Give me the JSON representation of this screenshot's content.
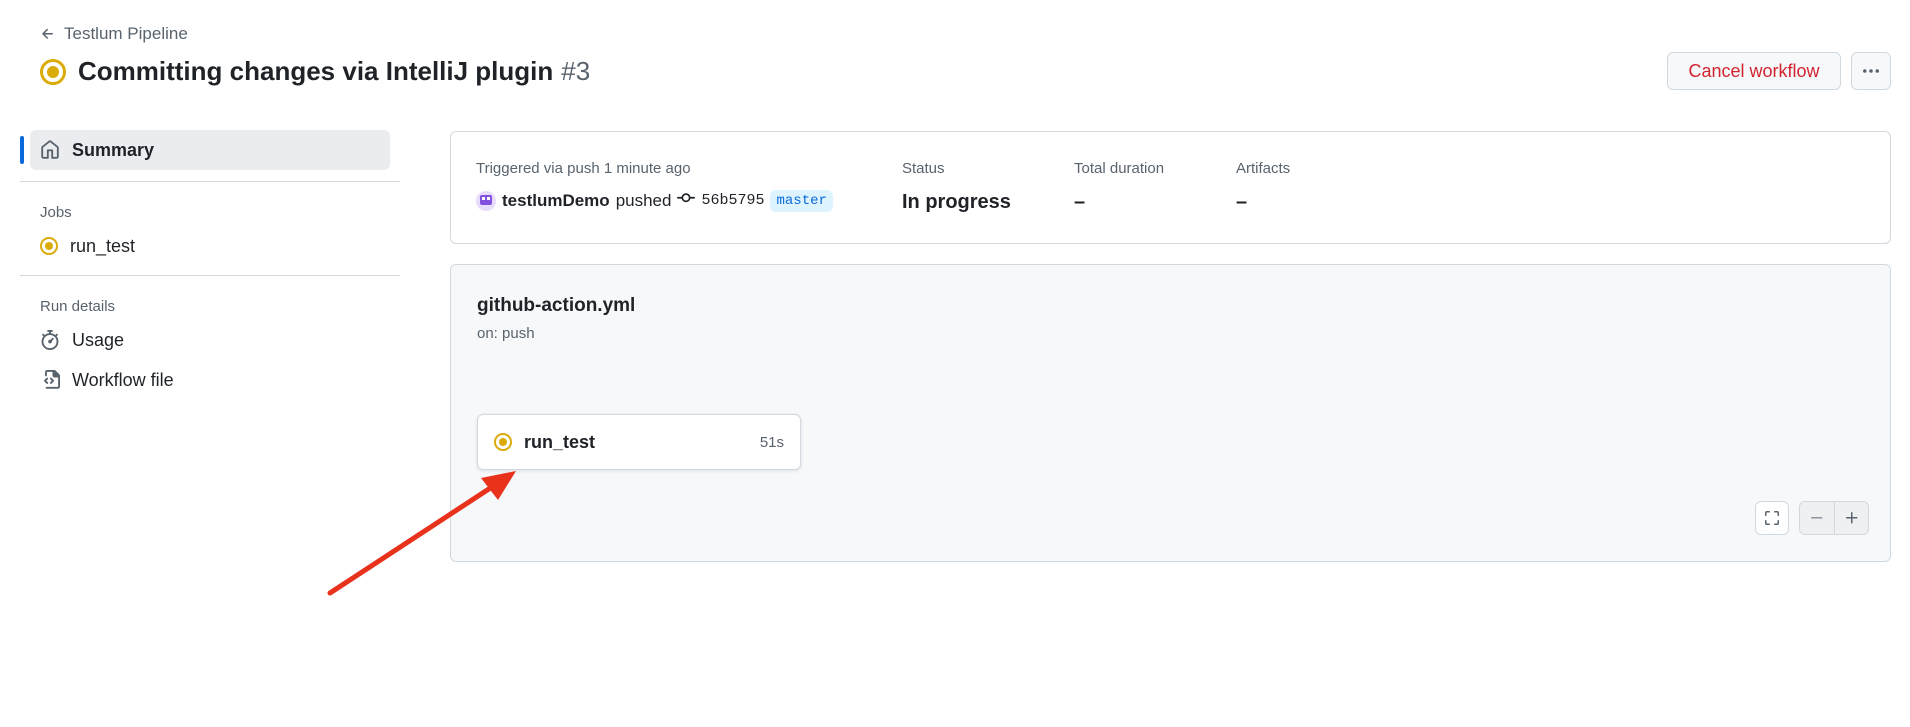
{
  "header": {
    "back_label": "Testlum Pipeline",
    "title": "Committing changes via IntelliJ plugin",
    "run_number": "#3",
    "cancel_label": "Cancel workflow"
  },
  "sidebar": {
    "summary_label": "Summary",
    "jobs_heading": "Jobs",
    "jobs": [
      {
        "label": "run_test",
        "status": "in-progress"
      }
    ],
    "details_heading": "Run details",
    "details": [
      {
        "label": "Usage",
        "icon": "stopwatch-icon"
      },
      {
        "label": "Workflow file",
        "icon": "file-code-icon"
      }
    ]
  },
  "summary": {
    "trigger_label": "Triggered via push 1 minute ago",
    "actor": "testlumDemo",
    "action": "pushed",
    "commit_sha": "56b5795",
    "branch": "master",
    "status_label": "Status",
    "status_value": "In progress",
    "duration_label": "Total duration",
    "duration_value": "–",
    "artifacts_label": "Artifacts",
    "artifacts_value": "–"
  },
  "graph": {
    "workflow_file": "github-action.yml",
    "trigger": "on: push",
    "jobs": [
      {
        "name": "run_test",
        "duration": "51s",
        "status": "in-progress"
      }
    ]
  },
  "colors": {
    "in_progress": "#dbab0a",
    "danger": "#d1242f",
    "accent": "#0969da",
    "annotation_arrow": "#e8321c"
  }
}
